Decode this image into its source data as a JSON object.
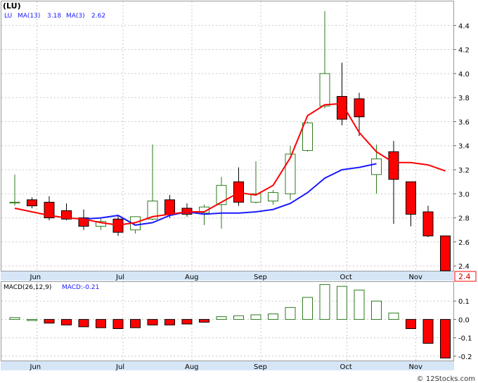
{
  "ticker": "(LU)",
  "legend": {
    "symbol": "LU",
    "ma13_label": "MA(13)",
    "ma13_value": "3.18",
    "ma3_label": "MA(3)",
    "ma3_value": "2.62"
  },
  "macd_legend": {
    "params": "MACD(26,12,9)",
    "value": "MACD:-0.21"
  },
  "last_price_label": "2.4",
  "watermark": "© 12Stocks.com",
  "colors": {
    "up": "#2d7a1e",
    "down": "#ff0000",
    "ma13": "#1a1aff",
    "ma3": "#ff0000",
    "grid": "#c8c8c8",
    "axis_bg": "#d6e6f7"
  },
  "chart_data": [
    {
      "type": "candlestick",
      "period": "weekly",
      "y_axis_side": "right",
      "ylim": [
        2.36,
        4.6
      ],
      "yticks": [
        2.4,
        2.6,
        2.8,
        3.0,
        3.2,
        3.4,
        3.6,
        3.8,
        4.0,
        4.2,
        4.4
      ],
      "ytick_labels": [
        "2.4",
        "2.6",
        "2.8",
        "3.0",
        "3.2",
        "3.4",
        "3.6",
        "3.8",
        "4.0",
        "4.2",
        "4.4"
      ],
      "month_labels": [
        {
          "label": "Jun",
          "week": 1
        },
        {
          "label": "Jul",
          "week": 6
        },
        {
          "label": "Aug",
          "week": 10
        },
        {
          "label": "Sep",
          "week": 14
        },
        {
          "label": "Oct",
          "week": 19
        },
        {
          "label": "Nov",
          "week": 23
        }
      ],
      "candles": [
        {
          "o": 2.93,
          "h": 3.16,
          "l": 2.9,
          "c": 2.93
        },
        {
          "o": 2.95,
          "h": 2.97,
          "l": 2.88,
          "c": 2.9
        },
        {
          "o": 2.93,
          "h": 2.98,
          "l": 2.78,
          "c": 2.8
        },
        {
          "o": 2.86,
          "h": 2.92,
          "l": 2.78,
          "c": 2.79
        },
        {
          "o": 2.8,
          "h": 2.87,
          "l": 2.7,
          "c": 2.73
        },
        {
          "o": 2.73,
          "h": 2.8,
          "l": 2.7,
          "c": 2.77
        },
        {
          "o": 2.79,
          "h": 2.82,
          "l": 2.65,
          "c": 2.68
        },
        {
          "o": 2.7,
          "h": 2.8,
          "l": 2.67,
          "c": 2.81
        },
        {
          "o": 2.79,
          "h": 3.41,
          "l": 2.78,
          "c": 2.94
        },
        {
          "o": 2.95,
          "h": 2.99,
          "l": 2.8,
          "c": 2.83
        },
        {
          "o": 2.88,
          "h": 2.92,
          "l": 2.81,
          "c": 2.83
        },
        {
          "o": 2.84,
          "h": 2.91,
          "l": 2.74,
          "c": 2.89
        },
        {
          "o": 2.91,
          "h": 3.14,
          "l": 2.71,
          "c": 3.07
        },
        {
          "o": 3.1,
          "h": 3.22,
          "l": 2.9,
          "c": 2.93
        },
        {
          "o": 2.93,
          "h": 3.27,
          "l": 2.92,
          "c": 3.0
        },
        {
          "o": 2.94,
          "h": 3.03,
          "l": 2.91,
          "c": 3.01
        },
        {
          "o": 3.0,
          "h": 3.4,
          "l": 2.95,
          "c": 3.33
        },
        {
          "o": 3.36,
          "h": 3.6,
          "l": 3.35,
          "c": 3.59
        },
        {
          "o": 3.73,
          "h": 4.52,
          "l": 3.71,
          "c": 4.0
        },
        {
          "o": 3.81,
          "h": 4.09,
          "l": 3.57,
          "c": 3.62
        },
        {
          "o": 3.79,
          "h": 3.84,
          "l": 3.48,
          "c": 3.64
        },
        {
          "o": 3.16,
          "h": 3.41,
          "l": 3.0,
          "c": 3.29
        },
        {
          "o": 3.35,
          "h": 3.44,
          "l": 2.75,
          "c": 3.12
        },
        {
          "o": 3.1,
          "h": 3.1,
          "l": 2.73,
          "c": 2.83
        },
        {
          "o": 2.85,
          "h": 2.9,
          "l": 2.64,
          "c": 2.65
        },
        {
          "o": 2.65,
          "h": 2.65,
          "l": 2.36,
          "c": 2.36
        }
      ],
      "series": [
        {
          "name": "MA(13)",
          "color": "#1a1aff",
          "start_week": 4,
          "values": [
            2.79,
            2.8,
            2.82,
            2.74,
            2.76,
            2.82,
            2.85,
            2.83,
            2.84,
            2.84,
            2.85,
            2.87,
            2.92,
            3.01,
            3.13,
            3.2,
            3.22,
            3.25
          ]
        },
        {
          "name": "MA(3)",
          "color": "#ff0000",
          "start_week": 0,
          "values": [
            2.88,
            2.85,
            2.82,
            2.8,
            2.79,
            2.76,
            2.74,
            2.76,
            2.81,
            2.83,
            2.85,
            2.85,
            2.93,
            3.01,
            2.99,
            3.07,
            3.3,
            3.65,
            3.74,
            3.75,
            3.51,
            3.35,
            3.26,
            3.26,
            3.24,
            3.19
          ]
        }
      ]
    },
    {
      "type": "bar",
      "name": "MACD",
      "ylim": [
        -0.22,
        0.2
      ],
      "yticks": [
        0.1,
        0.0,
        -0.1,
        -0.2
      ],
      "ytick_labels": [
        "0.1",
        "0.0",
        "-0.1",
        "-0.2"
      ],
      "values": [
        0.01,
        0.0,
        -0.02,
        -0.03,
        -0.04,
        -0.045,
        -0.05,
        -0.045,
        -0.03,
        -0.03,
        -0.025,
        -0.015,
        0.015,
        0.02,
        0.025,
        0.03,
        0.065,
        0.12,
        0.19,
        0.18,
        0.16,
        0.1,
        0.035,
        -0.05,
        -0.13,
        -0.21
      ]
    }
  ]
}
